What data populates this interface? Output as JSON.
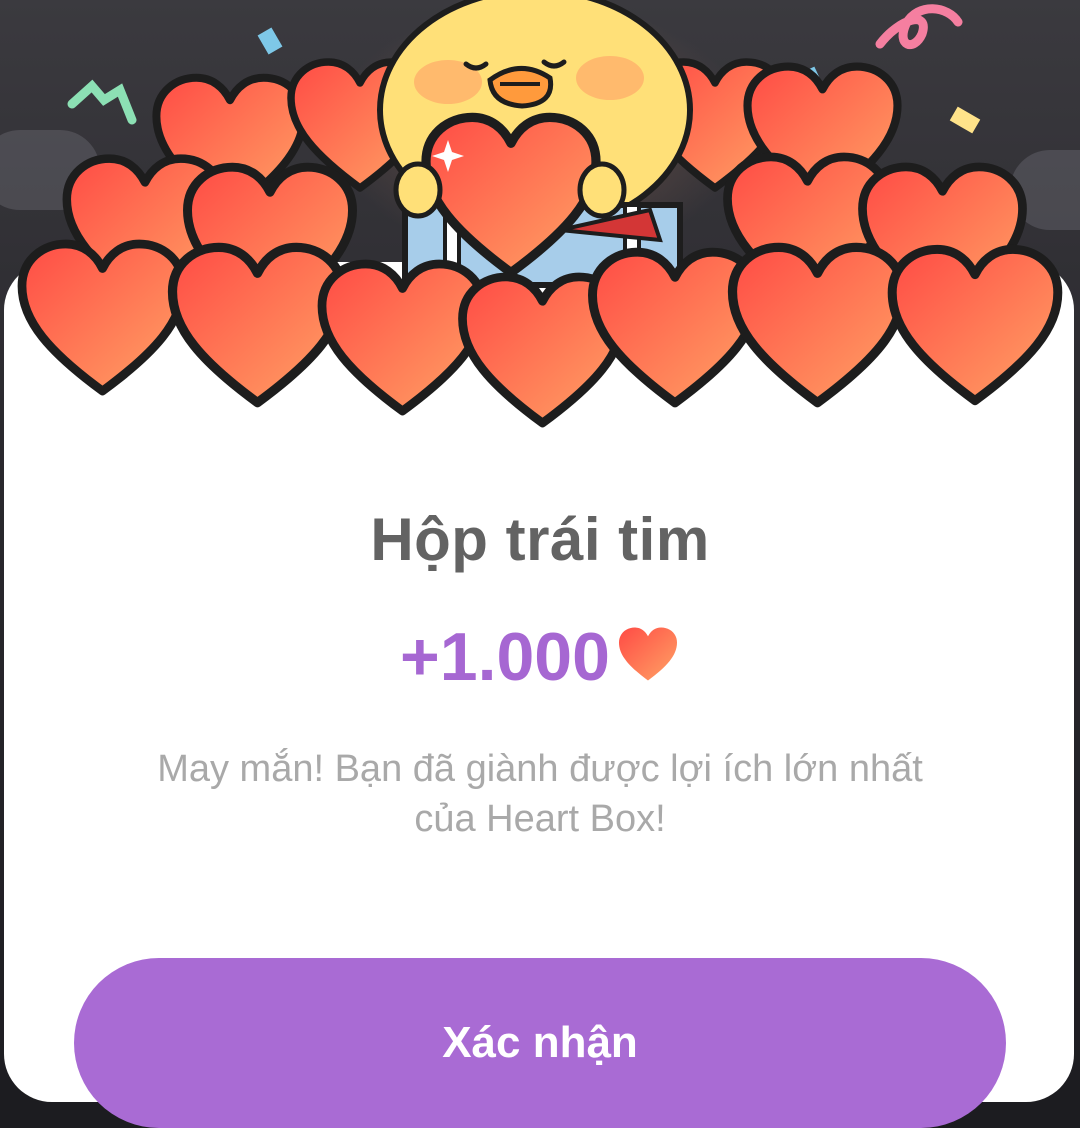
{
  "dialog": {
    "title": "Hộp trái tim",
    "reward_amount": "+1.000",
    "reward_icon": "heart-icon",
    "message": "May mắn! Bạn đã giành được lợi ích lớn nhất của Heart Box!",
    "confirm_label": "Xác nhận"
  },
  "colors": {
    "accent": "#a96bd4",
    "reward_text": "#a667d2",
    "title_text": "#636363",
    "message_text": "#a9a9a9",
    "heart": "#ff5a4a"
  }
}
